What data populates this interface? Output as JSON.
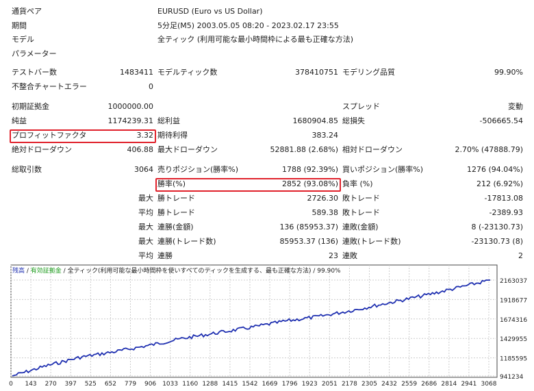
{
  "header": {
    "pair_label": "通貨ペア",
    "pair_value": "EURUSD (Euro vs US Dollar)",
    "period_label": "期間",
    "period_value": "5分足(M5) 2003.05.05 08:20 - 2023.02.17 23:55",
    "model_label": "モデル",
    "model_value": "全ティック (利用可能な最小時間枠による最も正確な方法)",
    "params_label": "パラメーター"
  },
  "stats": {
    "bars_label": "テストバー数",
    "bars_value": "1483411",
    "ticks_label": "モデルティック数",
    "ticks_value": "378410751",
    "quality_label": "モデリング品質",
    "quality_value": "99.90%",
    "mismatch_label": "不整合チャートエラー",
    "mismatch_value": "0",
    "deposit_label": "初期証拠金",
    "deposit_value": "1000000.00",
    "spread_label": "スプレッド",
    "spread_value": "変動",
    "netprofit_label": "純益",
    "netprofit_value": "1174239.31",
    "grossprofit_label": "総利益",
    "grossprofit_value": "1680904.85",
    "grossloss_label": "総損失",
    "grossloss_value": "-506665.54",
    "pf_label": "プロフィットファクタ",
    "pf_value": "3.32",
    "payoff_label": "期待利得",
    "payoff_value": "383.24",
    "absdd_label": "絶対ドローダウン",
    "absdd_value": "406.88",
    "maxdd_label": "最大ドローダウン",
    "maxdd_value": "52881.88 (2.68%)",
    "reldd_label": "相対ドローダウン",
    "reldd_value": "2.70% (47888.79)",
    "trades_label": "総取引数",
    "trades_value": "3064",
    "short_label": "売りポジション(勝率%)",
    "short_value": "1788 (92.39%)",
    "long_label": "買いポジション(勝率%)",
    "long_value": "1276 (94.04%)",
    "winrate_label": "勝率(%)",
    "winrate_value": "2852 (93.08%)",
    "lossrate_label": "負率 (%)",
    "lossrate_value": "212 (6.92%)",
    "max1": "最大",
    "maxwin_label": "勝トレード",
    "maxwin_value": "2726.30",
    "maxloss_label": "敗トレード",
    "maxloss_value": "-17813.08",
    "avg1": "平均",
    "avgwin_label": "勝トレード",
    "avgwin_value": "589.38",
    "avgloss_label": "敗トレード",
    "avgloss_value": "-2389.93",
    "max2": "最大",
    "consecwin_amt_label": "連勝(金額)",
    "consecwin_amt_value": "136 (85953.37)",
    "consecloss_amt_label": "連敗(金額)",
    "consecloss_amt_value": "8 (-23130.73)",
    "max3": "最大",
    "consecwin_cnt_label": "連勝(トレード数)",
    "consecwin_cnt_value": "85953.37 (136)",
    "consecloss_cnt_label": "連敗(トレード数)",
    "consecloss_cnt_value": "-23130.73 (8)",
    "avg2": "平均",
    "avgconsecwin_label": "連勝",
    "avgconsecwin_value": "23",
    "avgconsecloss_label": "連敗",
    "avgconsecloss_value": "2"
  },
  "legend": {
    "balance": "残高",
    "sep1": " / ",
    "equity": "有効証拠金",
    "sep2": " / ",
    "desc": "全ティック(利用可能な最小時間枠を使いすべてのティックを生成する、最も正確な方法)",
    "sep3": " / ",
    "quality": "99.90%"
  },
  "chart_data": {
    "type": "line",
    "series": [
      {
        "values": [
          941234,
          1070000,
          1180000,
          1250000,
          1330000,
          1420000,
          1490000,
          1560000,
          1640000,
          1700000,
          1780000,
          1870000,
          1960000,
          2060000,
          2163037
        ]
      }
    ],
    "x_ticks": [
      "0",
      "143",
      "270",
      "397",
      "525",
      "652",
      "779",
      "906",
      "1033",
      "1160",
      "1288",
      "1415",
      "1542",
      "1669",
      "1796",
      "1923",
      "2051",
      "2178",
      "2305",
      "2432",
      "2559",
      "2686",
      "2814",
      "2941",
      "3068"
    ],
    "y_ticks": [
      "2163037",
      "1918677",
      "1674316",
      "1429955",
      "1185595",
      "941234"
    ],
    "xlim": [
      0,
      3084
    ],
    "ylim": [
      941234,
      2163037
    ],
    "colors": {
      "balance": "#1e2fb0"
    }
  }
}
